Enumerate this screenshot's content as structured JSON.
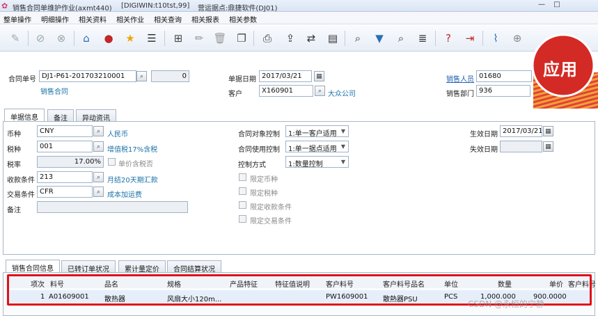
{
  "titlebar": {
    "app_title": "销售合同单维护作业(axmt440)",
    "server": "[DIGIWIN:t10tst,99]",
    "site": "营运据点:鼎捷软件(DJ01)"
  },
  "menu": [
    "整单操作",
    "明细操作",
    "相关资料",
    "相关作业",
    "相关查询",
    "相关报表",
    "相关参数"
  ],
  "badge": {
    "label": "应用"
  },
  "header": {
    "contract_no_label": "合同单号",
    "contract_no": "DJ1-P61-201703210001",
    "version": "0",
    "contract_type": "销售合同",
    "doc_date_label": "单据日期",
    "doc_date": "2017/03/21",
    "customer_label": "客户",
    "customer_code": "X160901",
    "customer_name": "大众公司",
    "salesperson_label": "销售人员",
    "salesperson_code": "01680",
    "dept_label": "销售部门",
    "dept_code": "936"
  },
  "tabs_top": [
    "单据信息",
    "备注",
    "异动资讯"
  ],
  "form": {
    "currency_label": "币种",
    "currency_code": "CNY",
    "currency_name": "人民币",
    "tax_label": "税种",
    "tax_code": "001",
    "tax_name": "增值税17%含税",
    "rate_label": "税率",
    "rate_value": "17.00%",
    "tax_included_label": "单价含税否",
    "payment_label": "收款条件",
    "payment_code": "213",
    "payment_name": "月结20天期汇款",
    "trade_label": "交易条件",
    "trade_code": "CFR",
    "trade_name": "成本加运费",
    "remark_label": "备注",
    "object_control_label": "合同对象控制",
    "object_control_value": "1:单一客户适用",
    "usage_control_label": "合同使用控制",
    "usage_control_value": "1:单一据点适用",
    "control_mode_label": "控制方式",
    "control_mode_value": "1:数量控制",
    "limits": [
      "限定币种",
      "限定税种",
      "限定收款条件",
      "限定交易条件"
    ],
    "effective_date_label": "生效日期",
    "effective_date": "2017/03/21",
    "expire_date_label": "失效日期"
  },
  "tabs_bottom": [
    "销售合同信息",
    "已转订单状况",
    "累计量定价",
    "合同结算状况"
  ],
  "grid": {
    "columns": [
      "项次",
      "料号",
      "品名",
      "规格",
      "产品特征",
      "特征值说明",
      "客户料号",
      "客户料号品名",
      "单位",
      "数量",
      "单价",
      "客户料号"
    ],
    "rows": [
      [
        "1",
        "A01609001",
        "散热器",
        "风扇大小120m...",
        "",
        "",
        "PW1609001",
        "散熱器PSU",
        "PCS",
        "1,000.000",
        "900.0000",
        ""
      ]
    ]
  },
  "watermark": "CSDN @永恒的宁静"
}
